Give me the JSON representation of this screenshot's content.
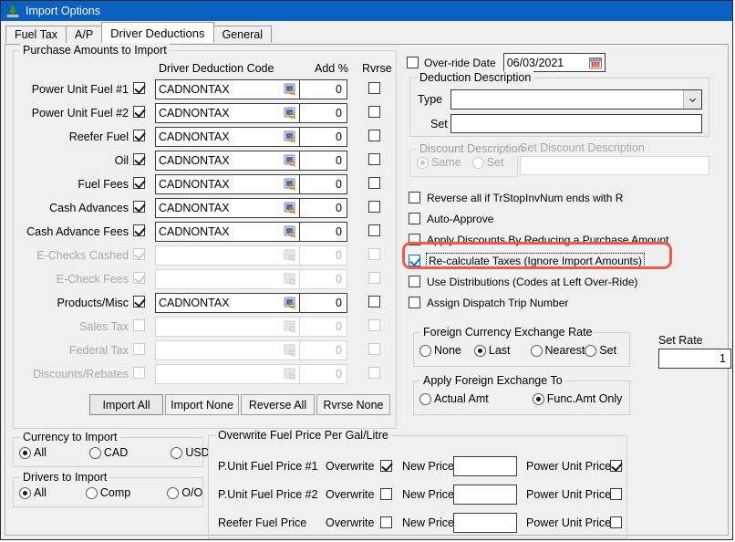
{
  "window": {
    "title": "Import Options",
    "icon": "import-arrow-icon",
    "titlebar_color": "#0a5fc2"
  },
  "tabs": [
    {
      "label": "Fuel Tax",
      "active": false
    },
    {
      "label": "A/P",
      "active": false
    },
    {
      "label": "Driver Deductions",
      "active": true
    },
    {
      "label": "General",
      "active": false
    }
  ],
  "purchase_group": {
    "title": "Purchase Amounts to Import",
    "columns": {
      "code": "Driver Deduction Code",
      "add_pct": "Add %",
      "rvrse": "Rvrse"
    },
    "rows": [
      {
        "label": "Power Unit Fuel #1",
        "enabled": true,
        "import_checked": true,
        "code": "CADNONTAX",
        "add_pct": "0",
        "rvrse_checked": false
      },
      {
        "label": "Power Unit Fuel #2",
        "enabled": true,
        "import_checked": true,
        "code": "CADNONTAX",
        "add_pct": "0",
        "rvrse_checked": false
      },
      {
        "label": "Reefer Fuel",
        "enabled": true,
        "import_checked": true,
        "code": "CADNONTAX",
        "add_pct": "0",
        "rvrse_checked": false
      },
      {
        "label": "Oil",
        "enabled": true,
        "import_checked": true,
        "code": "CADNONTAX",
        "add_pct": "0",
        "rvrse_checked": false
      },
      {
        "label": "Fuel Fees",
        "enabled": true,
        "import_checked": true,
        "code": "CADNONTAX",
        "add_pct": "0",
        "rvrse_checked": false
      },
      {
        "label": "Cash Advances",
        "enabled": true,
        "import_checked": true,
        "code": "CADNONTAX",
        "add_pct": "0",
        "rvrse_checked": false
      },
      {
        "label": "Cash Advance Fees",
        "enabled": true,
        "import_checked": true,
        "code": "CADNONTAX",
        "add_pct": "0",
        "rvrse_checked": false
      },
      {
        "label": "E-Checks Cashed",
        "enabled": false,
        "import_checked": true,
        "code": "",
        "add_pct": "0",
        "rvrse_checked": false
      },
      {
        "label": "E-Check Fees",
        "enabled": false,
        "import_checked": true,
        "code": "",
        "add_pct": "0",
        "rvrse_checked": false
      },
      {
        "label": "Products/Misc",
        "enabled": true,
        "import_checked": true,
        "code": "CADNONTAX",
        "add_pct": "0",
        "rvrse_checked": false
      },
      {
        "label": "Sales Tax",
        "enabled": false,
        "import_checked": false,
        "code": "",
        "add_pct": "0",
        "rvrse_checked": false
      },
      {
        "label": "Federal Tax",
        "enabled": false,
        "import_checked": false,
        "code": "",
        "add_pct": "0",
        "rvrse_checked": false
      },
      {
        "label": "Discounts/Rebates",
        "enabled": false,
        "import_checked": false,
        "code": "",
        "add_pct": "0",
        "rvrse_checked": false
      }
    ],
    "buttons": [
      {
        "label": "Import All",
        "focused": true
      },
      {
        "label": "Import None",
        "focused": false
      },
      {
        "label": "Reverse All",
        "focused": false
      },
      {
        "label": "Rvrse None",
        "focused": false
      }
    ]
  },
  "override_date": {
    "checkbox_label": "Over-ride Date",
    "checked": false,
    "value": "06/03/2021",
    "icon": "calendar-icon"
  },
  "deduction_description": {
    "title": "Deduction Description",
    "type_label": "Type",
    "type_value": "",
    "set_label": "Set",
    "set_value": ""
  },
  "discount_description": {
    "title": "Discount Description",
    "enabled": false,
    "options": [
      {
        "label": "Same",
        "selected": true
      },
      {
        "label": "Set",
        "selected": false
      }
    ],
    "field_label": "Set Discount Description",
    "field_value": ""
  },
  "options": [
    {
      "label": "Reverse all if TrStopInvNum ends with R",
      "checked": false,
      "highlighted": false
    },
    {
      "label": "Auto-Approve",
      "checked": false,
      "highlighted": false
    },
    {
      "label": "Apply Discounts By Reducing a Purchase Amount",
      "checked": false,
      "highlighted": false
    },
    {
      "label": "Re-calculate Taxes (Ignore Import Amounts)",
      "checked": true,
      "highlighted": true
    },
    {
      "label": "Use Distributions (Codes at Left Over-Ride)",
      "checked": false,
      "highlighted": false
    },
    {
      "label": "Assign Dispatch Trip Number",
      "checked": false,
      "highlighted": false
    }
  ],
  "annotation_color": "#f2594c",
  "fx_rate": {
    "title": "Foreign Currency Exchange Rate",
    "options": [
      {
        "label": "None",
        "selected": false
      },
      {
        "label": "Last",
        "selected": true
      },
      {
        "label": "Nearest",
        "selected": false
      },
      {
        "label": "Set",
        "selected": false
      }
    ]
  },
  "set_rate": {
    "label": "Set Rate",
    "value": "1"
  },
  "apply_fx": {
    "title": "Apply Foreign Exchange To",
    "options": [
      {
        "label": "Actual Amt",
        "selected": false
      },
      {
        "label": "Func.Amt Only",
        "selected": true
      }
    ]
  },
  "currency_to_import": {
    "title": "Currency to Import",
    "options": [
      {
        "label": "All",
        "selected": true
      },
      {
        "label": "CAD",
        "selected": false
      },
      {
        "label": "USD",
        "selected": false
      }
    ]
  },
  "drivers_to_import": {
    "title": "Drivers to Import",
    "options": [
      {
        "label": "All",
        "selected": true
      },
      {
        "label": "Comp",
        "selected": false
      },
      {
        "label": "O/O",
        "selected": false
      }
    ]
  },
  "overwrite_fuel": {
    "title": "Overwrite Fuel Price Per Gal/Litre",
    "overwrite_label": "Overwrite",
    "new_price_label": "New Price",
    "power_unit_label": "Power Unit Price",
    "rows": [
      {
        "label": "P.Unit Fuel Price #1",
        "overwrite_checked": true,
        "new_price": "",
        "power_unit_checked": true
      },
      {
        "label": "P.Unit Fuel Price #2",
        "overwrite_checked": false,
        "new_price": "",
        "power_unit_checked": false
      },
      {
        "label": "Reefer Fuel Price",
        "overwrite_checked": false,
        "new_price": "",
        "power_unit_checked": false
      }
    ]
  }
}
